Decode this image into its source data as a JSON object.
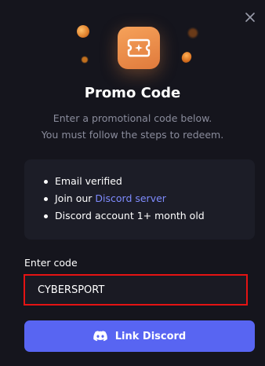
{
  "modal": {
    "title": "Promo Code",
    "subtitle_line1": "Enter a promotional code below.",
    "subtitle_line2": "You must follow the steps to redeem.",
    "close_icon": "close-icon",
    "hero_icon": "ticket-icon"
  },
  "requirements": {
    "item1": "Email verified",
    "item2_prefix": "Join our ",
    "item2_link": "Discord server",
    "item3": "Discord account 1+ month old"
  },
  "code": {
    "label": "Enter code",
    "value": "CYBERSPORT"
  },
  "button": {
    "label": "Link Discord",
    "icon": "discord-icon"
  },
  "colors": {
    "background": "#15151d",
    "card": "#1c1d27",
    "accent": "#5865f2",
    "link": "#7f8cff",
    "highlight_border": "#e41313",
    "tile_orange": "#f09050"
  }
}
